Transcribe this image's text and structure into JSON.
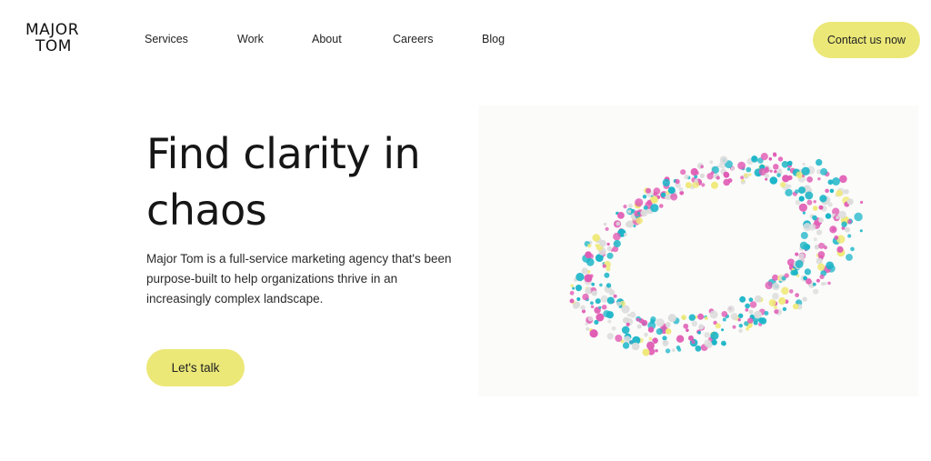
{
  "brand": {
    "logo_line1": "MAJOR",
    "logo_line2": "TOM"
  },
  "nav": {
    "items": [
      {
        "label": "Services"
      },
      {
        "label": "Work"
      },
      {
        "label": "About"
      },
      {
        "label": "Careers"
      },
      {
        "label": "Blog"
      }
    ],
    "contact_label": "Contact us now"
  },
  "hero": {
    "title": "Find clarity in chaos",
    "description": "Major Tom is a full-service marketing agency that's been purpose-built to help organizations thrive in an increasingly complex landscape.",
    "cta_label": "Let's talk"
  },
  "colors": {
    "accent": "#ebe878",
    "dot_pink": "#e05bb4",
    "dot_cyan": "#1bb5c8",
    "dot_yellow": "#efe978",
    "dot_grey": "#dcdcdc"
  }
}
